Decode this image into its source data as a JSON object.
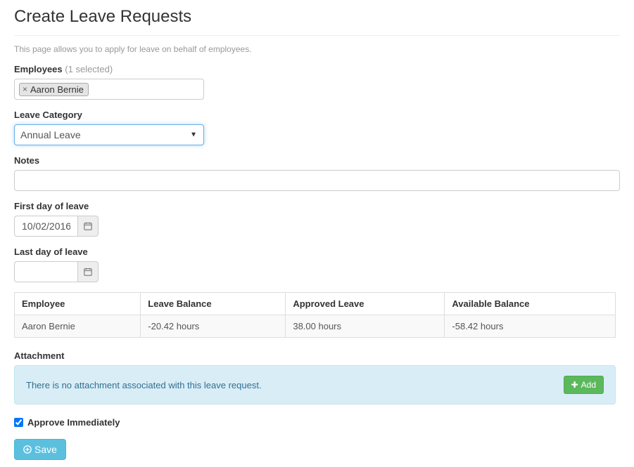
{
  "page": {
    "title": "Create Leave Requests",
    "description": "This page allows you to apply for leave on behalf of employees."
  },
  "employees_field": {
    "label": "Employees",
    "count_text": "(1 selected)",
    "selected": [
      {
        "name": "Aaron Bernie"
      }
    ]
  },
  "leave_category": {
    "label": "Leave Category",
    "value": "Annual Leave"
  },
  "notes": {
    "label": "Notes",
    "value": ""
  },
  "first_day": {
    "label": "First day of leave",
    "value": "10/02/2016"
  },
  "last_day": {
    "label": "Last day of leave",
    "value": ""
  },
  "balance_table": {
    "headers": {
      "employee": "Employee",
      "leave_balance": "Leave Balance",
      "approved_leave": "Approved Leave",
      "available_balance": "Available Balance"
    },
    "rows": [
      {
        "employee": "Aaron Bernie",
        "leave_balance": "-20.42 hours",
        "approved_leave": "38.00 hours",
        "available_balance": "-58.42 hours"
      }
    ]
  },
  "attachment": {
    "label": "Attachment",
    "empty_message": "There is no attachment associated with this leave request.",
    "add_label": "Add"
  },
  "approve_immediately": {
    "label": "Approve Immediately",
    "checked": true
  },
  "save": {
    "label": "Save"
  }
}
